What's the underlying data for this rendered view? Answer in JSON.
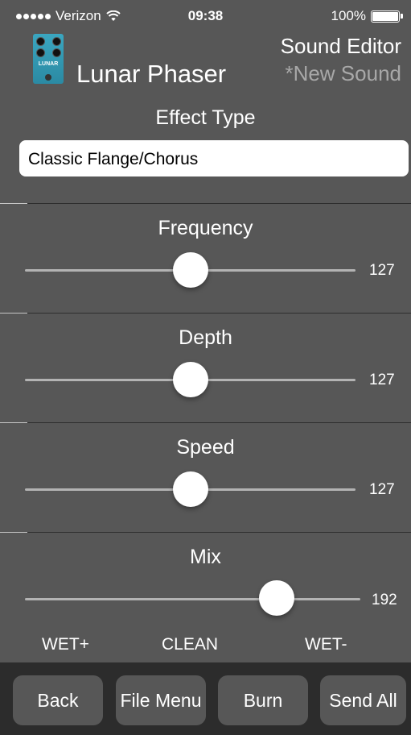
{
  "status": {
    "carrier": "Verizon",
    "time": "09:38",
    "battery": "100%",
    "battery_level": 1.0
  },
  "header": {
    "device_name": "Lunar Phaser",
    "editor_title": "Sound Editor",
    "sound_name": "*New Sound",
    "pedal_text": "LUNAR"
  },
  "effect": {
    "label": "Effect Type",
    "value": "Classic Flange/Chorus"
  },
  "sliders": [
    {
      "label": "Frequency",
      "value": "127",
      "level": 0.5
    },
    {
      "label": "Depth",
      "value": "127",
      "level": 0.5
    },
    {
      "label": "Speed",
      "value": "127",
      "level": 0.5
    },
    {
      "label": "Mix",
      "value": "192",
      "level": 0.75
    }
  ],
  "mix_labels": {
    "left": "WET+",
    "center": "CLEAN",
    "right": "WET-"
  },
  "toolbar": {
    "back": "Back",
    "file_menu": "File Menu",
    "burn": "Burn",
    "send_all": "Send All"
  },
  "colors": {
    "background": "#575757",
    "toolbar": "#2c2c2c",
    "subtitle": "#a8a8a8"
  }
}
